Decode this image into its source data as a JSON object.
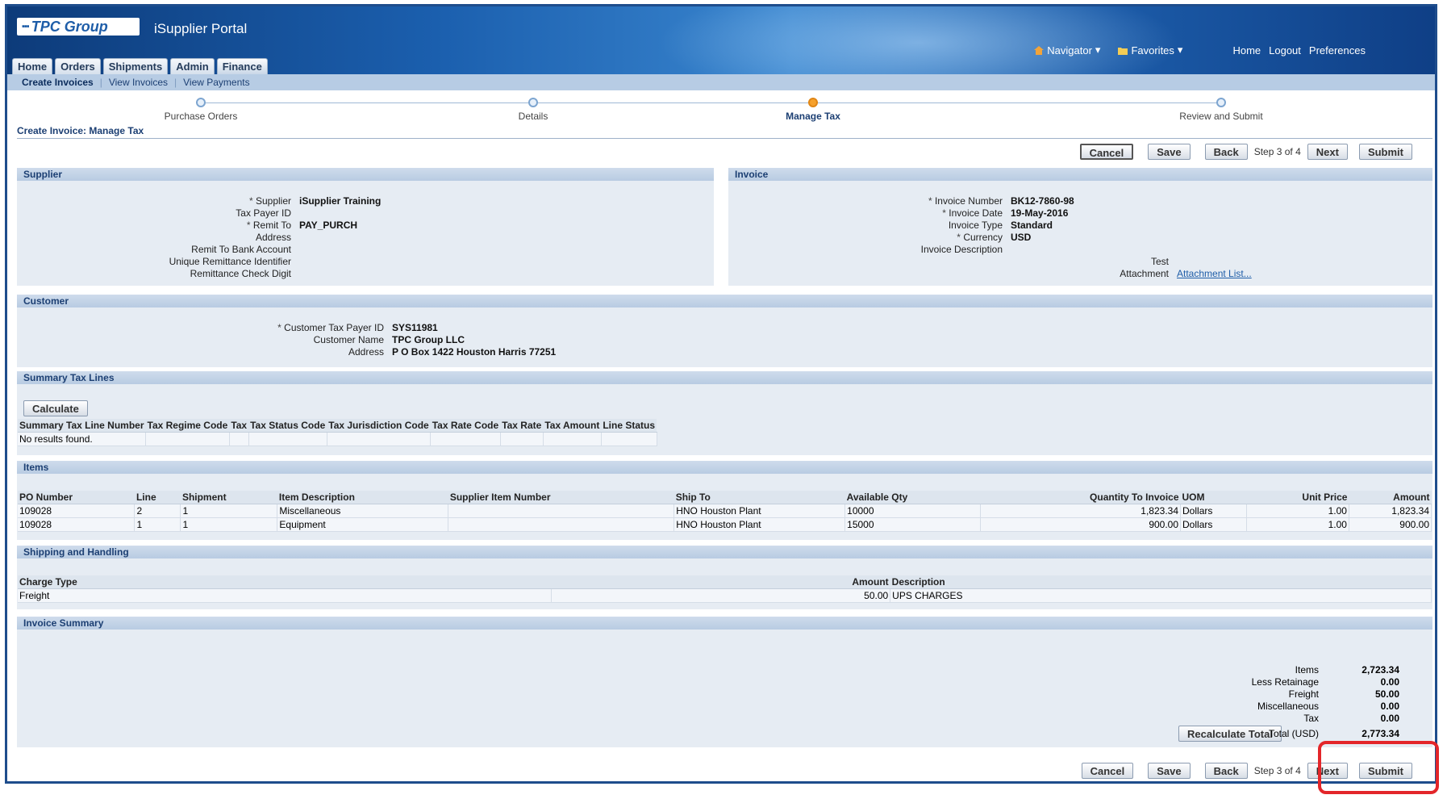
{
  "header": {
    "logo": "TPC Group",
    "app_title": "iSupplier Portal",
    "navigator": "Navigator",
    "favorites": "Favorites",
    "home": "Home",
    "logout": "Logout",
    "preferences": "Preferences"
  },
  "tabs": [
    {
      "label": "Home"
    },
    {
      "label": "Orders"
    },
    {
      "label": "Shipments"
    },
    {
      "label": "Admin"
    },
    {
      "label": "Finance"
    }
  ],
  "subnav": [
    "Create Invoices",
    "View Invoices",
    "View Payments"
  ],
  "train": [
    "Purchase Orders",
    "Details",
    "Manage Tax",
    "Review and Submit"
  ],
  "page_title": "Create Invoice: Manage Tax",
  "buttons": {
    "cancel": "Cancel",
    "save": "Save",
    "back": "Back",
    "step": "Step 3 of 4",
    "next": "Next",
    "submit": "Submit",
    "calculate": "Calculate",
    "recalculate": "Recalculate Total"
  },
  "supplier": {
    "title": "Supplier",
    "fields": [
      {
        "label": "Supplier",
        "required": true,
        "value": "iSupplier Training"
      },
      {
        "label": "Tax Payer ID",
        "required": false,
        "value": ""
      },
      {
        "label": "Remit To",
        "required": true,
        "value": "PAY_PURCH"
      },
      {
        "label": "Address",
        "required": false,
        "value": ""
      },
      {
        "label": "Remit To Bank Account",
        "required": false,
        "value": ""
      },
      {
        "label": "Unique Remittance Identifier",
        "required": false,
        "value": ""
      },
      {
        "label": "Remittance Check Digit",
        "required": false,
        "value": ""
      }
    ]
  },
  "invoice": {
    "title": "Invoice",
    "fields": [
      {
        "label": "Invoice Number",
        "required": true,
        "value": "BK12-7860-98"
      },
      {
        "label": "Invoice Date",
        "required": true,
        "value": "19-May-2016"
      },
      {
        "label": "Invoice Type",
        "required": false,
        "value": "Standard"
      },
      {
        "label": "Currency",
        "required": true,
        "value": "USD"
      },
      {
        "label": "Invoice Description",
        "required": false,
        "value": ""
      }
    ],
    "description_value": "Test",
    "attachment_label": "Attachment",
    "attachment_link": "Attachment List..."
  },
  "customer": {
    "title": "Customer",
    "fields": [
      {
        "label": "Customer Tax Payer ID",
        "required": true,
        "value": "SYS11981"
      },
      {
        "label": "Customer Name",
        "required": false,
        "value": "TPC Group LLC"
      },
      {
        "label": "Address",
        "required": false,
        "value": "P O Box 1422 Houston Harris 77251"
      }
    ]
  },
  "summary_tax": {
    "title": "Summary Tax Lines",
    "columns": [
      "Summary Tax Line Number",
      "Tax Regime Code",
      "Tax",
      "Tax Status Code",
      "Tax Jurisdiction Code",
      "Tax Rate Code",
      "Tax Rate",
      "Tax Amount",
      "Line Status"
    ],
    "empty": "No results found."
  },
  "items": {
    "title": "Items",
    "columns": [
      "PO Number",
      "Line",
      "Shipment",
      "Item Description",
      "Supplier Item Number",
      "Ship To",
      "Available Qty",
      "Quantity To Invoice",
      "UOM",
      "Unit Price",
      "Amount"
    ],
    "rows": [
      [
        "109028",
        "2",
        "1",
        "Miscellaneous",
        "",
        "HNO Houston Plant",
        "10000",
        "1,823.34",
        "Dollars",
        "1.00",
        "1,823.34"
      ],
      [
        "109028",
        "1",
        "1",
        "Equipment",
        "",
        "HNO Houston Plant",
        "15000",
        "900.00",
        "Dollars",
        "1.00",
        "900.00"
      ]
    ]
  },
  "shipping": {
    "title": "Shipping and Handling",
    "columns": [
      "Charge Type",
      "Amount",
      "Description"
    ],
    "rows": [
      [
        "Freight",
        "50.00",
        "UPS CHARGES"
      ]
    ]
  },
  "invoice_summary": {
    "title": "Invoice Summary",
    "rows": [
      {
        "label": "Items",
        "value": "2,723.34"
      },
      {
        "label": "Less Retainage",
        "value": "0.00"
      },
      {
        "label": "Freight",
        "value": "50.00"
      },
      {
        "label": "Miscellaneous",
        "value": "0.00"
      },
      {
        "label": "Tax",
        "value": "0.00"
      }
    ],
    "total_label": "Total (USD)",
    "total_value": "2,773.34"
  },
  "colors": {
    "header_blue": "#1b5fae",
    "section_bg": "#e6ecf3",
    "highlight": "#e3262a",
    "current_step": "#f6a12c"
  }
}
